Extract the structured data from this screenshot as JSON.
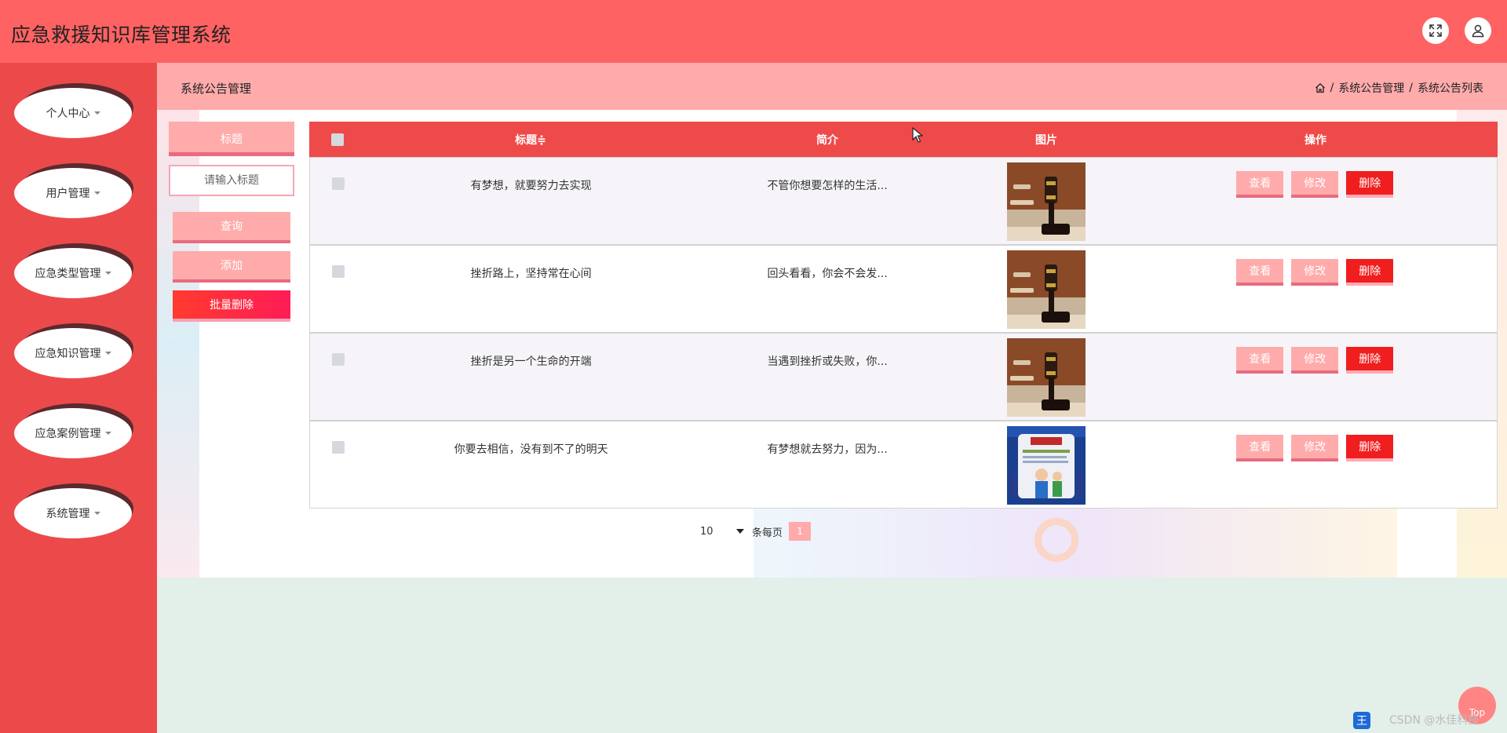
{
  "header": {
    "app_title": "应急救援知识库管理系统",
    "fullscreen_icon": "fullscreen-icon",
    "user_icon": "user-icon"
  },
  "sidebar": {
    "items": [
      {
        "label": "个人中心"
      },
      {
        "label": "用户管理"
      },
      {
        "label": "应急类型管理"
      },
      {
        "label": "应急知识管理"
      },
      {
        "label": "应急案例管理"
      },
      {
        "label": "系统管理"
      }
    ]
  },
  "page": {
    "title": "系统公告管理",
    "breadcrumb": [
      "系统公告管理",
      "系统公告列表"
    ],
    "breadcrumb_sep": "/"
  },
  "filters": {
    "title_label": "标题",
    "title_placeholder": "请输入标题",
    "query_label": "查询",
    "add_label": "添加",
    "batch_delete_label": "批量删除"
  },
  "table": {
    "columns": {
      "title": "标题≑",
      "intro": "简介",
      "picture": "图片",
      "ops": "操作"
    },
    "ops": {
      "view": "查看",
      "edit": "修改",
      "delete": "删除"
    },
    "rows": [
      {
        "title": "有梦想，就要努力去实现",
        "intro": "不管你想要怎样的生活...",
        "picture": "gavel"
      },
      {
        "title": "挫折路上，坚持常在心间",
        "intro": "回头看看，你会不会发...",
        "picture": "gavel"
      },
      {
        "title": "挫折是另一个生命的开端",
        "intro": "当遇到挫折或失败，你...",
        "picture": "gavel"
      },
      {
        "title": "你要去相信，没有到不了的明天",
        "intro": "有梦想就去努力，因为...",
        "picture": "poster"
      }
    ]
  },
  "pagination": {
    "page_size": "10",
    "per_page_label": "条每页",
    "current_page": "1"
  },
  "misc": {
    "top_label": "Top",
    "watermark": "CSDN @水佳科技"
  },
  "colors": {
    "header": "#ff6262",
    "sidebar": "#ec4a4a",
    "accent_light": "#ffabab",
    "table_head": "#ef4a4a",
    "delete": "#f01e1e"
  }
}
